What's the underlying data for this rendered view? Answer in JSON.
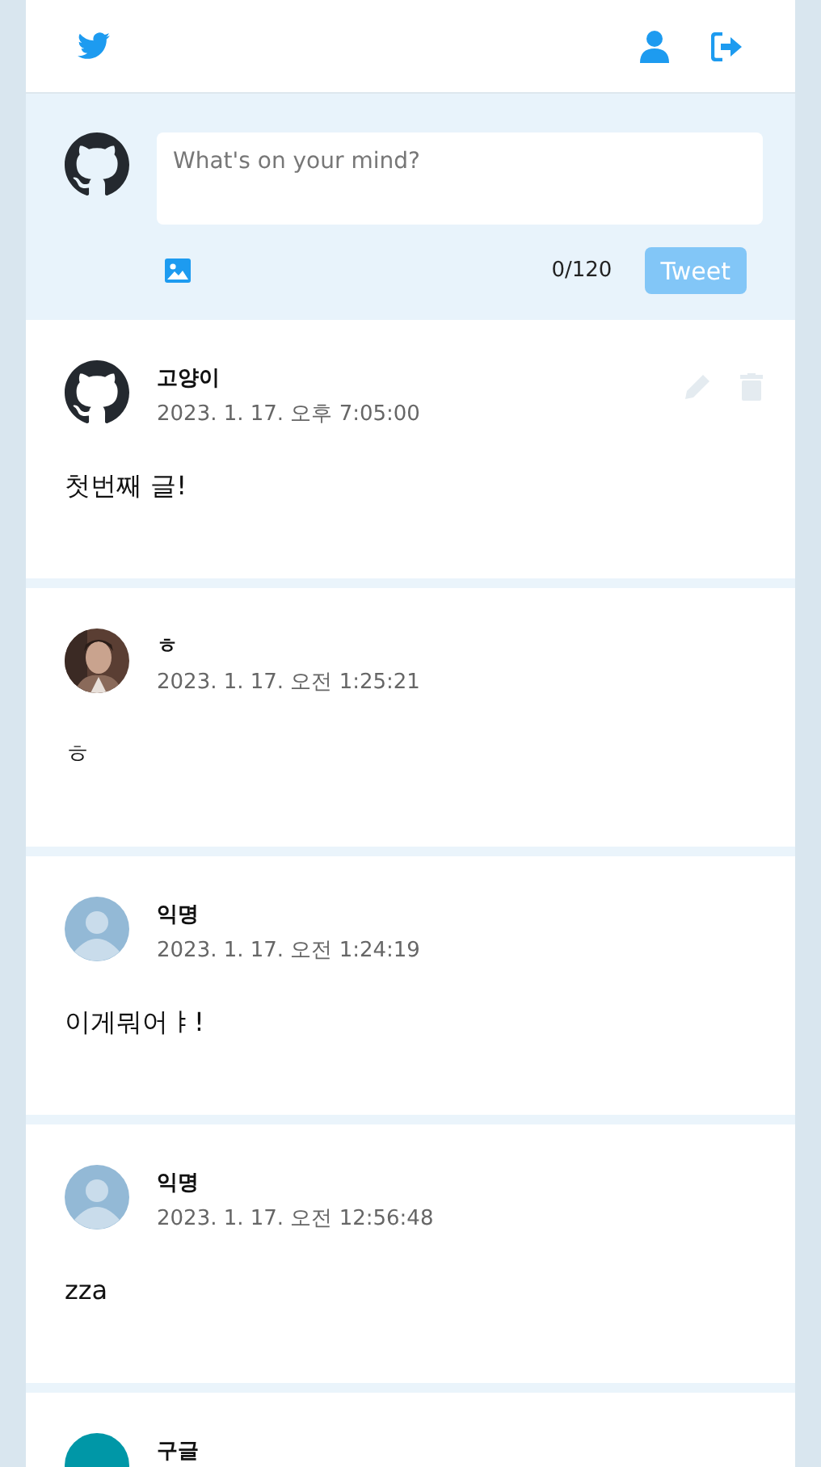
{
  "composer": {
    "placeholder": "What's on your mind?",
    "counter": "0/120",
    "submit": {
      "label": "Tweet",
      "disabled": true
    }
  },
  "tweets": [
    {
      "author": "고양이",
      "date": "2023. 1. 17. 오후 7:05:00",
      "text": "첫번째 글!",
      "avatar": {
        "kind": "github"
      },
      "owner": true
    },
    {
      "author": "ㅎ",
      "date": "2023. 1. 17. 오전 1:25:21",
      "text": "ㅎ",
      "owner": false
    },
    {
      "author": "익명",
      "date": "2023. 1. 17. 오전 1:24:19",
      "text": "이게뭐어ㅑ!",
      "avatar": {
        "kind": "default"
      },
      "owner": false
    },
    {
      "author": "익명",
      "date": "2023. 1. 17. 오전 12:56:48",
      "text": "zza",
      "avatar": {
        "kind": "default"
      },
      "owner": false
    },
    {
      "author": "구글",
      "avatar": {
        "kind": "letter",
        "color": "#0097a7"
      },
      "owner": false
    }
  ]
}
